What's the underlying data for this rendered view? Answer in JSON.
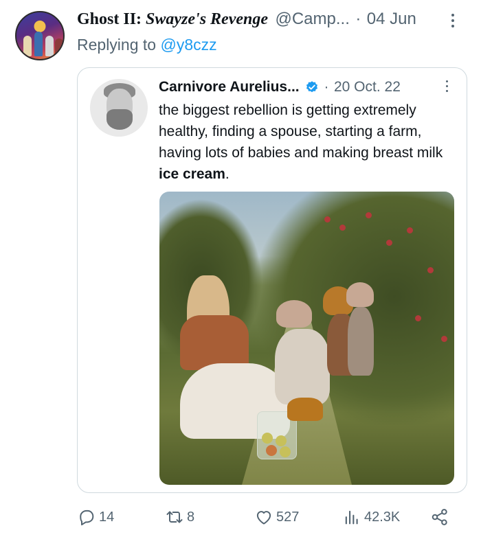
{
  "tweet": {
    "author_name_prefix": "Ghost II: ",
    "author_name_italic": "Swayze's Revenge",
    "handle": "@Camp...",
    "date": "04 Jun",
    "dot": "·",
    "replying_prefix": "Replying to ",
    "replying_mention": "@y8czz"
  },
  "quoted": {
    "author_name": "Carnivore Aurelius...",
    "dot": "·",
    "date": "20 Oct. 22",
    "text_main": "the biggest rebellion is getting extremely healthy, finding a spouse, starting a farm, having lots of babies and making breast milk ",
    "text_bold": "ice cream",
    "text_end": "."
  },
  "actions": {
    "replies": "14",
    "retweets": "8",
    "likes": "527",
    "views": "42.3K"
  },
  "colors": {
    "text": "#0f1419",
    "secondary": "#536471",
    "link": "#1d9bf0",
    "border": "#cfd9de",
    "verified": "#1d9bf0"
  },
  "icons": [
    "more-icon",
    "verified-badge-icon",
    "reply-icon",
    "retweet-icon",
    "like-icon",
    "views-icon",
    "share-icon"
  ]
}
